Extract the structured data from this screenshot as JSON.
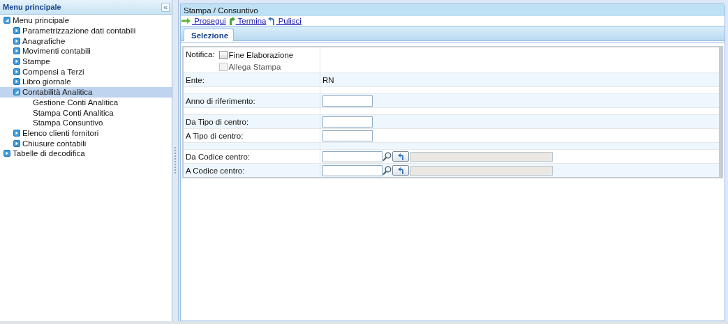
{
  "sidebar": {
    "title": "Menu principale",
    "collapse_symbol": "«",
    "tree": [
      {
        "label": "Menu principale",
        "expanded": true,
        "selected": false,
        "children": [
          {
            "label": "Parametrizzazione dati contabili",
            "expanded": false,
            "selected": false
          },
          {
            "label": "Anagrafiche",
            "expanded": false,
            "selected": false
          },
          {
            "label": "Movimenti contabili",
            "expanded": false,
            "selected": false
          },
          {
            "label": "Stampe",
            "expanded": false,
            "selected": false
          },
          {
            "label": "Compensi a Terzi",
            "expanded": false,
            "selected": false
          },
          {
            "label": "Libro giornale",
            "expanded": false,
            "selected": false
          },
          {
            "label": "Contabilità Analitica",
            "expanded": true,
            "selected": true,
            "children": [
              {
                "label": "Gestione Conti Analitica",
                "selected": false
              },
              {
                "label": "Stampa Conti Analitica",
                "selected": false
              },
              {
                "label": "Stampa Consuntivo",
                "selected": false
              }
            ]
          },
          {
            "label": "Elenco clienti fornitori",
            "expanded": false,
            "selected": false
          },
          {
            "label": "Chiusure contabili",
            "expanded": false,
            "selected": false
          }
        ]
      },
      {
        "label": "Tabelle di decodifica",
        "expanded": false,
        "selected": false
      }
    ]
  },
  "main": {
    "title": "Stampa / Consuntivo",
    "actions": [
      {
        "kind": "forward",
        "label": "Prosegui"
      },
      {
        "kind": "exit",
        "label": "Termina"
      },
      {
        "kind": "undo",
        "label": "Pulisci"
      }
    ],
    "tabs": [
      {
        "label": "Selezione",
        "selected": true
      }
    ],
    "form": [
      {
        "kind": "checkboxes",
        "label": "Notifica:",
        "options": [
          {
            "label": "Fine Elaborazione",
            "checked": false,
            "disabled": false
          },
          {
            "label": "Allega Stampa",
            "checked": false,
            "disabled": true
          }
        ]
      },
      {
        "kind": "text",
        "label": "Ente:",
        "value": "RN"
      },
      {
        "kind": "spacer"
      },
      {
        "kind": "input",
        "label": "Anno di riferimento:"
      },
      {
        "kind": "spacer"
      },
      {
        "kind": "input",
        "label": "Da Tipo di centro:"
      },
      {
        "kind": "input",
        "label": "A Tipo di centro:"
      },
      {
        "kind": "spacer"
      },
      {
        "kind": "lookup",
        "label": "Da Codice centro:"
      },
      {
        "kind": "lookup",
        "label": "A Codice centro:"
      }
    ]
  }
}
